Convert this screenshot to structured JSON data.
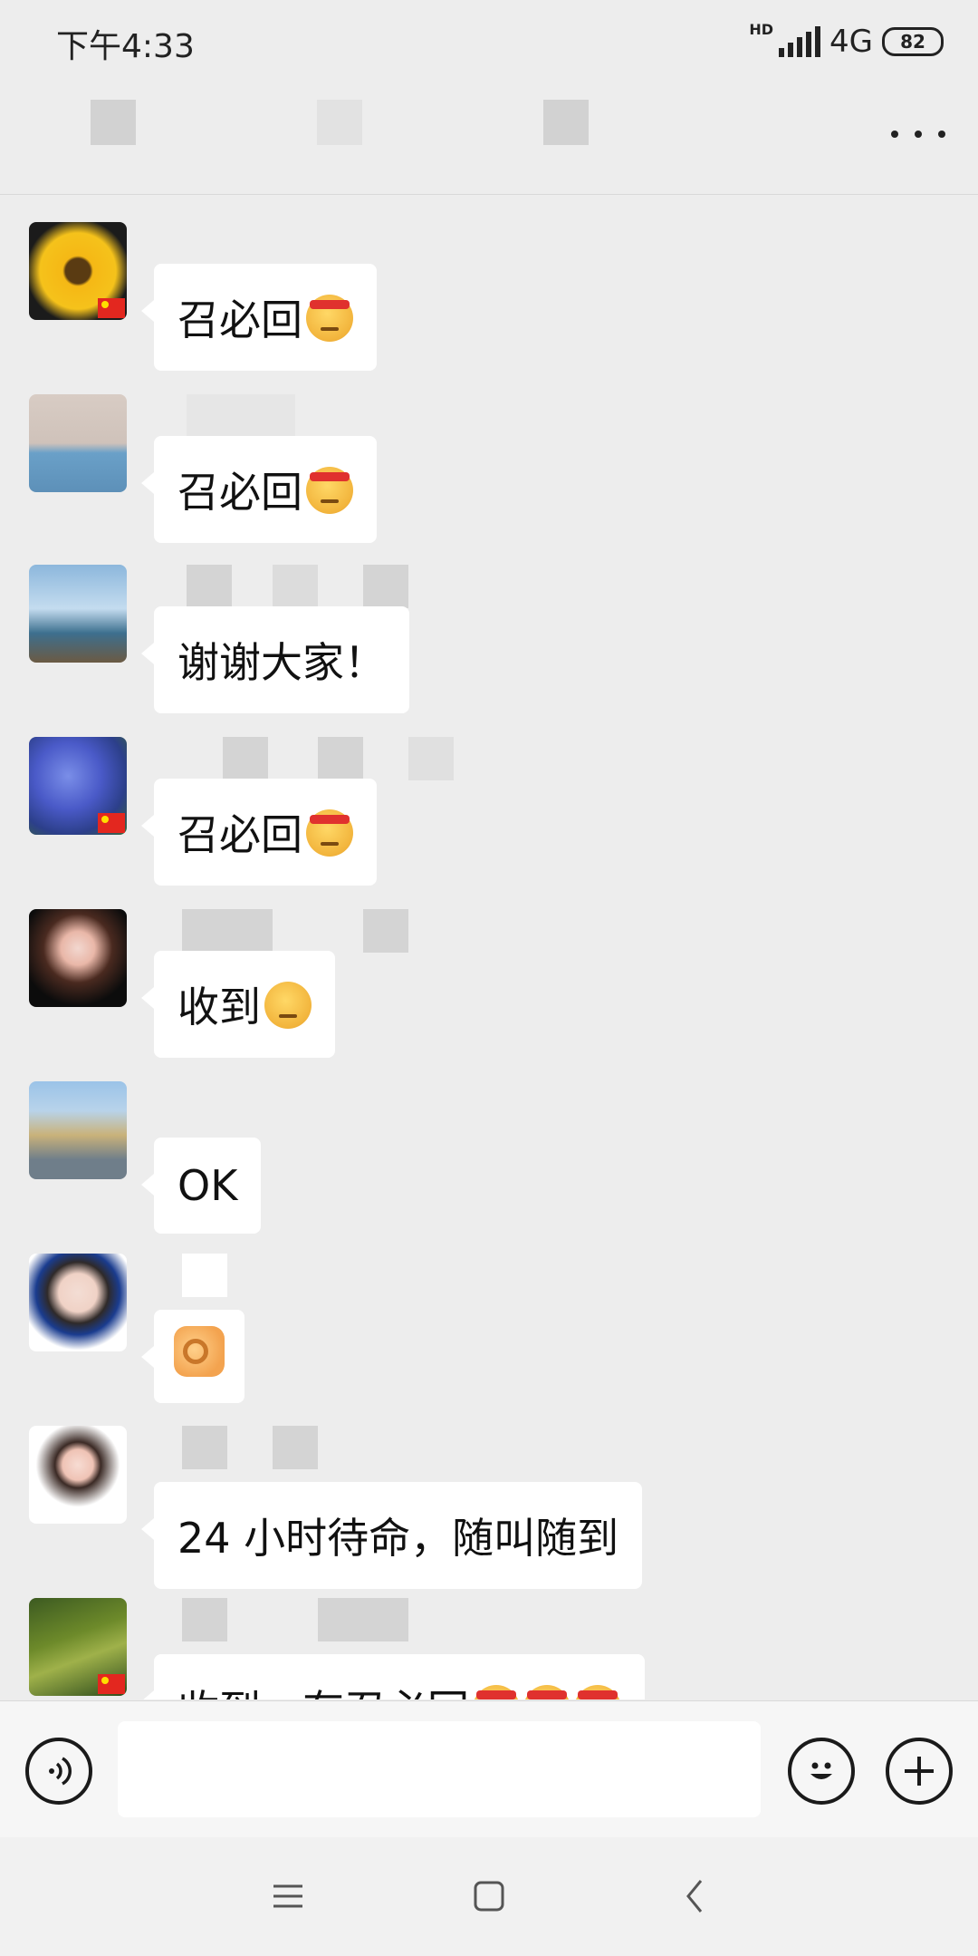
{
  "status_bar": {
    "time": "下午4:33",
    "hd": "HD",
    "network": "4G",
    "battery": "82"
  },
  "title_bar": {
    "more_icon": "more-dots-icon"
  },
  "messages": [
    {
      "text": "召必回",
      "emoji": "angry-face",
      "avatar": "sunflower"
    },
    {
      "text": "召必回",
      "emoji": "angry-face",
      "avatar": "girl-back"
    },
    {
      "text": "谢谢大家！",
      "emoji": "",
      "avatar": "boat-photo"
    },
    {
      "text": "召必回",
      "emoji": "angry-face",
      "avatar": "blue-flowers"
    },
    {
      "text": "收到",
      "emoji": "smirk-face",
      "avatar": "cartoon-girl"
    },
    {
      "text": "OK",
      "emoji": "",
      "avatar": "gate-photo"
    },
    {
      "text": "",
      "emoji": "ok-hand",
      "avatar": "woman-portrait"
    },
    {
      "text": "24 小时待命，随叫随到",
      "emoji": "",
      "avatar": "cartoon-child"
    },
    {
      "text": "收到，有召必回",
      "emoji": "angry-face-x3",
      "avatar": "grass"
    }
  ],
  "input_bar": {
    "voice_icon": "voice-icon",
    "emoji_icon": "emoji-icon",
    "plus_icon": "plus-icon",
    "placeholder": ""
  },
  "nav_bar": {
    "menu_icon": "menu-icon",
    "home_icon": "home-icon",
    "back_icon": "back-icon"
  },
  "colors": {
    "background": "#ededed",
    "bubble": "#ffffff",
    "text": "#111111"
  }
}
